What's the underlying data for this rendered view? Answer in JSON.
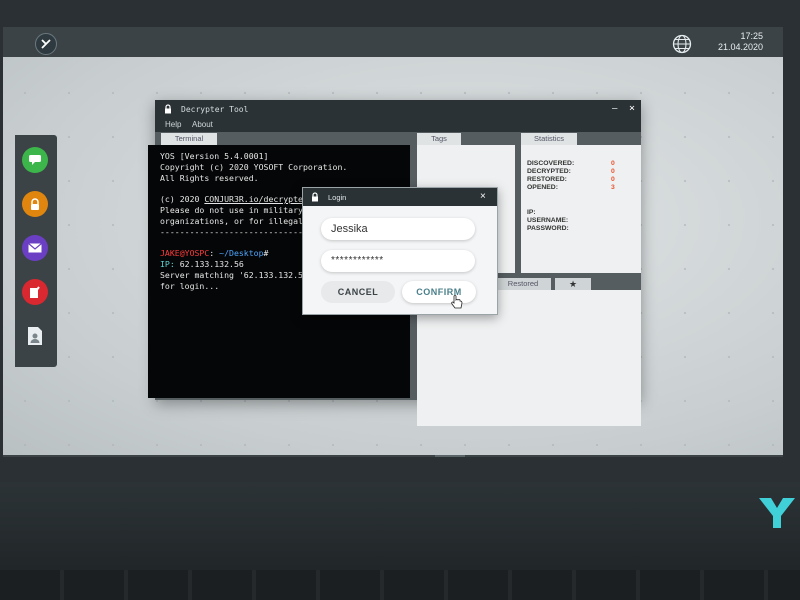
{
  "desktop": {
    "clock_time": "17:25",
    "clock_date": "21.04.2020"
  },
  "window": {
    "title": "Decrypter Tool",
    "menu": [
      "Help",
      "About"
    ],
    "tabs": {
      "terminal": "Terminal",
      "tags": "Tags",
      "statistics": "Statistics",
      "restored": "Restored"
    }
  },
  "terminal": {
    "lines": [
      "YOS [Version 5.4.0001]",
      "Copyright (c) 2020 YOSOFT Corporation.",
      "All Rights reserved.",
      "",
      "(c) 2020 CONJUR3R.io/decrypte",
      "Please do not use in military",
      "organizations, or for illegal",
      "------------------------------"
    ],
    "prompt_user": "JAKE@YOSPC",
    "prompt_path": "~/Desktop",
    "ip_label": "IP:",
    "ip_value": "62.133.132.56",
    "server_line": "Server matching '62.133.132.5",
    "login_line": "for login..."
  },
  "statistics": {
    "rows": [
      {
        "label": "DISCOVERED:",
        "value": "0"
      },
      {
        "label": "DECRYPTED:",
        "value": "0"
      },
      {
        "label": "RESTORED:",
        "value": "0"
      },
      {
        "label": "OPENED:",
        "value": "3"
      }
    ],
    "info": [
      "IP:",
      "USERNAME:",
      "PASSWORD:"
    ]
  },
  "login": {
    "title": "Login",
    "username": "Jessika",
    "password": "************",
    "cancel": "CANCEL",
    "confirm": "CONFIRM"
  },
  "colors": {
    "accent_red": "#e8552f",
    "prompt_red": "#ff3b3b",
    "prompt_blue": "#4da6ff",
    "ip_cyan": "#5fd4d4"
  }
}
